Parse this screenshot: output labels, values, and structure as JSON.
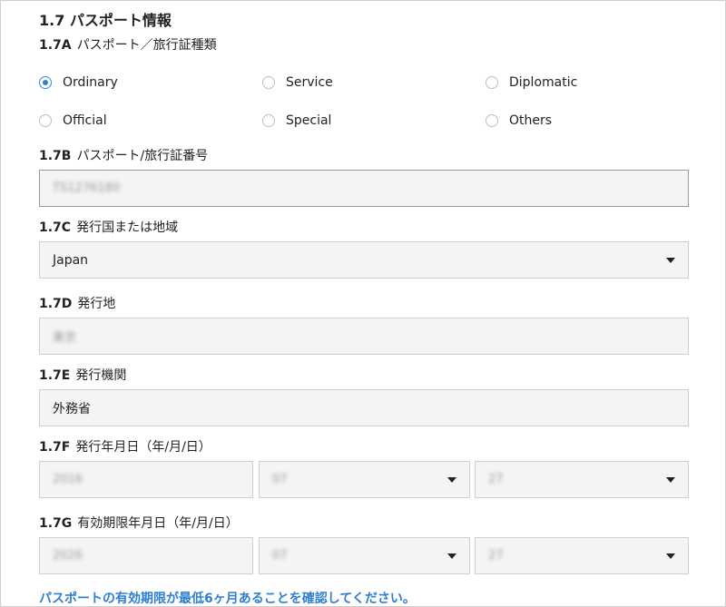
{
  "section": {
    "title": "1.7 パスポート情報"
  },
  "q_7a": {
    "code": "1.7A",
    "label": "パスポート／旅行証種類",
    "options": [
      "Ordinary",
      "Service",
      "Diplomatic",
      "Official",
      "Special",
      "Others"
    ],
    "selected": "Ordinary"
  },
  "q_7b": {
    "code": "1.7B",
    "label": "パスポート/旅行証番号",
    "value": "TS1276180"
  },
  "q_7c": {
    "code": "1.7C",
    "label": "発行国または地域",
    "value": "Japan"
  },
  "q_7d": {
    "code": "1.7D",
    "label": "発行地",
    "value": "東京"
  },
  "q_7e": {
    "code": "1.7E",
    "label": "発行機関",
    "value": "外務省"
  },
  "q_7f": {
    "code": "1.7F",
    "label": "発行年月日（年/月/日）",
    "year": "2016",
    "month": "07",
    "day": "27"
  },
  "q_7g": {
    "code": "1.7G",
    "label": "有効期限年月日（年/月/日）",
    "year": "2026",
    "month": "07",
    "day": "27"
  },
  "note": "パスポートの有効期限が最低6ヶ月あることを確認してください。",
  "colors": {
    "accent": "#2f7fcf",
    "field_bg": "#f4f4f4",
    "border": "#cfcfcf"
  }
}
